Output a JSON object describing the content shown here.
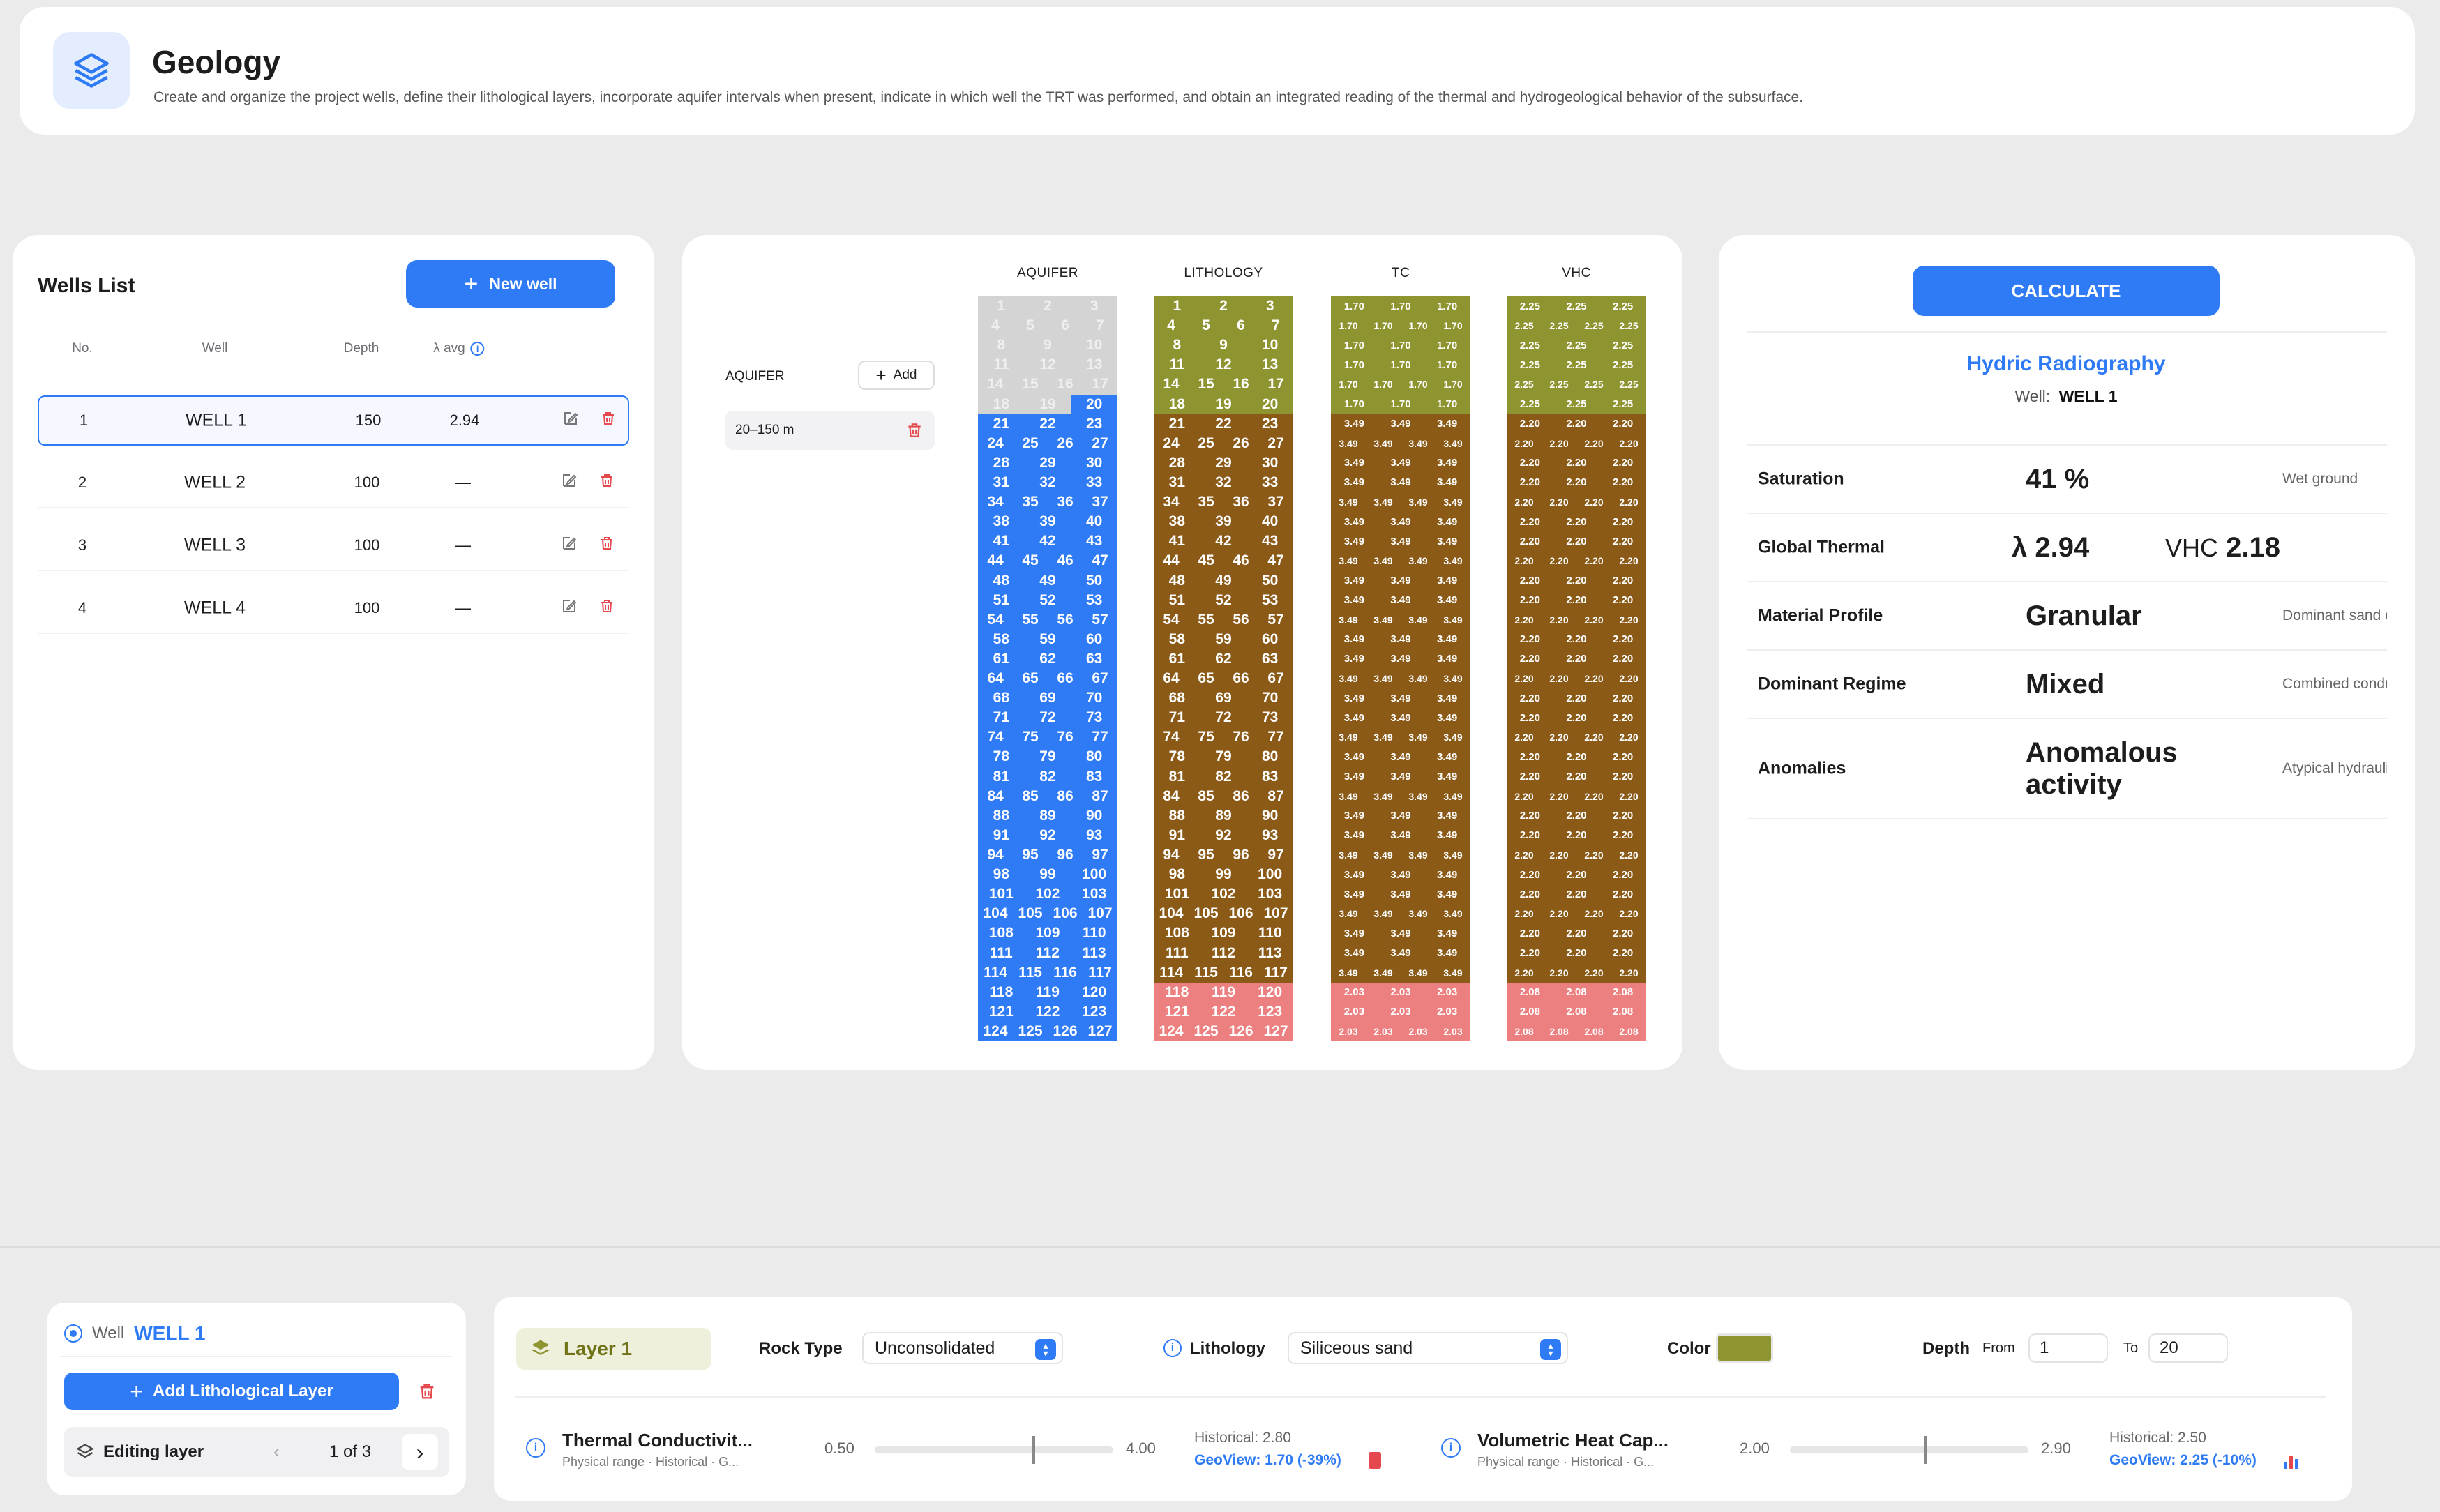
{
  "header": {
    "title": "Geology",
    "subtitle": "Create and organize the project wells, define their lithological layers, incorporate aquifer intervals when present, indicate in which well the TRT was performed, and obtain an integrated reading of the thermal and hydrogeological behavior of the subsurface."
  },
  "wells": {
    "title": "Wells List",
    "new_button": "New well",
    "headers": {
      "no": "No.",
      "well": "Well",
      "depth": "Depth",
      "lambda": "λ avg"
    },
    "rows": [
      {
        "no": "1",
        "name": "WELL 1",
        "depth": "150",
        "lambda": "2.94"
      },
      {
        "no": "2",
        "name": "WELL 2",
        "depth": "100",
        "lambda": "—"
      },
      {
        "no": "3",
        "name": "WELL 3",
        "depth": "100",
        "lambda": "—"
      },
      {
        "no": "4",
        "name": "WELL 4",
        "depth": "100",
        "lambda": "—"
      }
    ]
  },
  "grid": {
    "columns": [
      "AQUIFER",
      "LITHOLOGY",
      "TC",
      "VHC"
    ],
    "aquifer_label": "AQUIFER",
    "add_label": "Add",
    "interval": "20–150 m",
    "colors": {
      "empty": "#d4d4d4",
      "aquifer": "#2f7bf5",
      "layer1": "#8e9430",
      "layer2": "#8b5a17",
      "layer3": "#ec8080"
    },
    "tc_values": [
      "1.70",
      "3.49",
      "2.03"
    ],
    "vhc_values": [
      "2.25",
      "2.20",
      "2.08"
    ]
  },
  "results": {
    "calculate": "CALCULATE",
    "title": "Hydric Radiography",
    "well_label": "Well:",
    "well_value": "WELL 1",
    "rows": [
      {
        "label": "Saturation",
        "value": "41 %",
        "note": "Wet ground"
      },
      {
        "label": "Global Thermal",
        "lambda": "2.94",
        "vhc_label": "VHC",
        "vhc": "2.18"
      },
      {
        "label": "Material Profile",
        "value": "Granular",
        "note": "Dominant sand or gravel"
      },
      {
        "label": "Dominant Regime",
        "value": "Mixed",
        "note": "Combined conduction"
      },
      {
        "label": "Anomalies",
        "value": "Anomalous activity",
        "note": "Atypical hydraulic or"
      }
    ]
  },
  "editor": {
    "well_label": "Well",
    "well_value": "WELL 1",
    "add_layer": "Add Lithological Layer",
    "editing_label": "Editing layer",
    "pager": "1 of 3",
    "layer_name": "Layer 1",
    "rock_type_label": "Rock Type",
    "rock_type": "Unconsolidated",
    "lithology_label": "Lithology",
    "lithology": "Siliceous sand",
    "color_label": "Color",
    "layer_color": "#8e9430",
    "depth_label": "Depth",
    "from_label": "From",
    "from": "1",
    "to_label": "To",
    "to": "20",
    "tc": {
      "name": "Thermal Conductivit...",
      "sub": "Physical range · Historical · G...",
      "min": "0.50",
      "max": "4.00",
      "level": 0.66,
      "historical": "Historical: 2.80",
      "geoview": "GeoView: 1.70 (-39%)"
    },
    "vhc": {
      "name": "Volumetric Heat Cap...",
      "sub": "Physical range · Historical · G...",
      "min": "2.00",
      "max": "2.90",
      "level": 0.56,
      "historical": "Historical: 2.50",
      "geoview": "GeoView: 2.25 (-10%)"
    }
  }
}
